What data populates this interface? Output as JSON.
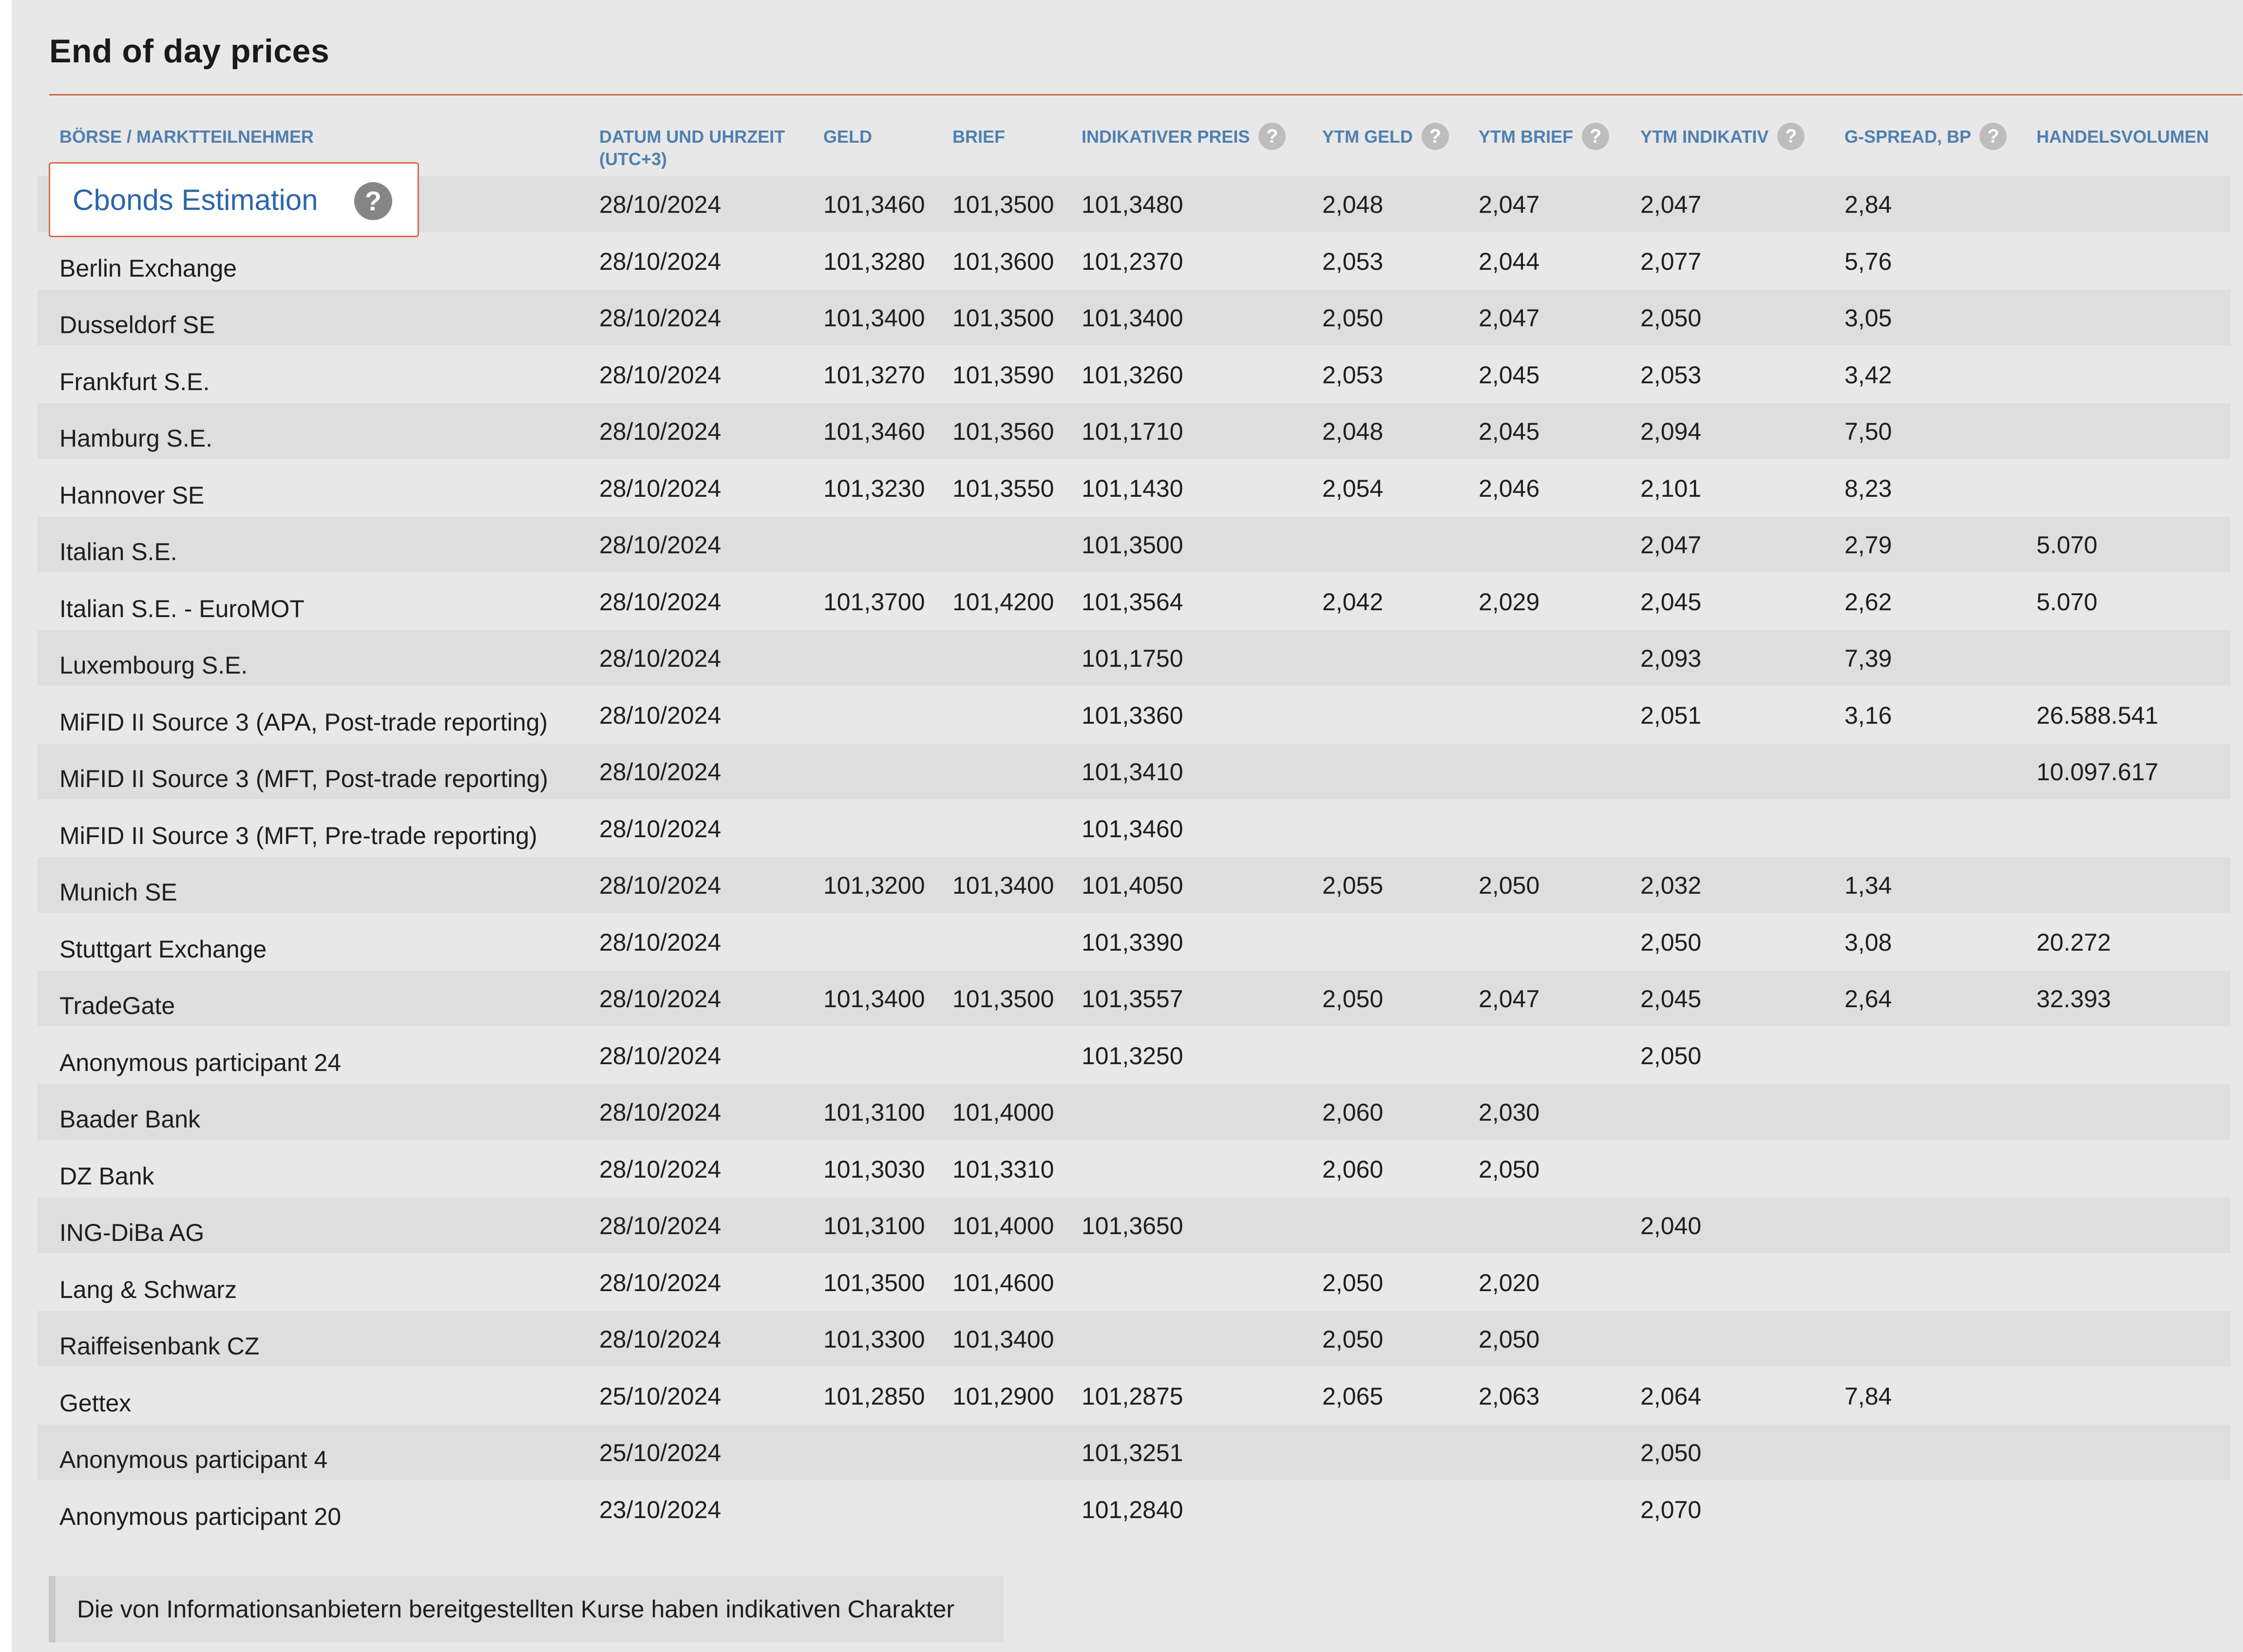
{
  "title": "End of day prices",
  "headers": {
    "exchange": "BÖRSE / MARKTTEILNEHMER",
    "datetime_line1": "DATUM UND UHRZEIT",
    "datetime_line2": "(UTC+3)",
    "bid": "GELD",
    "ask": "BRIEF",
    "indicative": "INDIKATIVER PREIS",
    "ytm_bid": "YTM GELD",
    "ytm_ask": "YTM BRIEF",
    "ytm_indicative": "YTM INDIKATIV",
    "g_spread": "G-SPREAD, BP",
    "volume": "HANDELSVOLUMEN"
  },
  "help_glyph": "?",
  "cbonds_link": "Cbonds Estimation",
  "rows": [
    {
      "name": "",
      "date": "28/10/2024",
      "bid": "101,3460",
      "ask": "101,3500",
      "ind": "101,3480",
      "ytm_bid": "2,048",
      "ytm_ask": "2,047",
      "ytm_ind": "2,047",
      "spread": "2,84",
      "vol": ""
    },
    {
      "name": "Berlin Exchange",
      "date": "28/10/2024",
      "bid": "101,3280",
      "ask": "101,3600",
      "ind": "101,2370",
      "ytm_bid": "2,053",
      "ytm_ask": "2,044",
      "ytm_ind": "2,077",
      "spread": "5,76",
      "vol": ""
    },
    {
      "name": "Dusseldorf SE",
      "date": "28/10/2024",
      "bid": "101,3400",
      "ask": "101,3500",
      "ind": "101,3400",
      "ytm_bid": "2,050",
      "ytm_ask": "2,047",
      "ytm_ind": "2,050",
      "spread": "3,05",
      "vol": ""
    },
    {
      "name": "Frankfurt S.E.",
      "date": "28/10/2024",
      "bid": "101,3270",
      "ask": "101,3590",
      "ind": "101,3260",
      "ytm_bid": "2,053",
      "ytm_ask": "2,045",
      "ytm_ind": "2,053",
      "spread": "3,42",
      "vol": ""
    },
    {
      "name": "Hamburg S.E.",
      "date": "28/10/2024",
      "bid": "101,3460",
      "ask": "101,3560",
      "ind": "101,1710",
      "ytm_bid": "2,048",
      "ytm_ask": "2,045",
      "ytm_ind": "2,094",
      "spread": "7,50",
      "vol": ""
    },
    {
      "name": "Hannover SE",
      "date": "28/10/2024",
      "bid": "101,3230",
      "ask": "101,3550",
      "ind": "101,1430",
      "ytm_bid": "2,054",
      "ytm_ask": "2,046",
      "ytm_ind": "2,101",
      "spread": "8,23",
      "vol": ""
    },
    {
      "name": "Italian S.E.",
      "date": "28/10/2024",
      "bid": "",
      "ask": "",
      "ind": "101,3500",
      "ytm_bid": "",
      "ytm_ask": "",
      "ytm_ind": "2,047",
      "spread": "2,79",
      "vol": "5.070"
    },
    {
      "name": "Italian S.E. - EuroMOT",
      "date": "28/10/2024",
      "bid": "101,3700",
      "ask": "101,4200",
      "ind": "101,3564",
      "ytm_bid": "2,042",
      "ytm_ask": "2,029",
      "ytm_ind": "2,045",
      "spread": "2,62",
      "vol": "5.070"
    },
    {
      "name": "Luxembourg S.E.",
      "date": "28/10/2024",
      "bid": "",
      "ask": "",
      "ind": "101,1750",
      "ytm_bid": "",
      "ytm_ask": "",
      "ytm_ind": "2,093",
      "spread": "7,39",
      "vol": ""
    },
    {
      "name": "MiFID II Source 3 (APA, Post-trade reporting)",
      "date": "28/10/2024",
      "bid": "",
      "ask": "",
      "ind": "101,3360",
      "ytm_bid": "",
      "ytm_ask": "",
      "ytm_ind": "2,051",
      "spread": "3,16",
      "vol": "26.588.541"
    },
    {
      "name": "MiFID II Source 3 (MFT, Post-trade reporting)",
      "date": "28/10/2024",
      "bid": "",
      "ask": "",
      "ind": "101,3410",
      "ytm_bid": "",
      "ytm_ask": "",
      "ytm_ind": "",
      "spread": "",
      "vol": "10.097.617"
    },
    {
      "name": "MiFID II Source 3 (MFT, Pre-trade reporting)",
      "date": "28/10/2024",
      "bid": "",
      "ask": "",
      "ind": "101,3460",
      "ytm_bid": "",
      "ytm_ask": "",
      "ytm_ind": "",
      "spread": "",
      "vol": ""
    },
    {
      "name": "Munich SE",
      "date": "28/10/2024",
      "bid": "101,3200",
      "ask": "101,3400",
      "ind": "101,4050",
      "ytm_bid": "2,055",
      "ytm_ask": "2,050",
      "ytm_ind": "2,032",
      "spread": "1,34",
      "vol": ""
    },
    {
      "name": "Stuttgart Exchange",
      "date": "28/10/2024",
      "bid": "",
      "ask": "",
      "ind": "101,3390",
      "ytm_bid": "",
      "ytm_ask": "",
      "ytm_ind": "2,050",
      "spread": "3,08",
      "vol": "20.272"
    },
    {
      "name": "TradeGate",
      "date": "28/10/2024",
      "bid": "101,3400",
      "ask": "101,3500",
      "ind": "101,3557",
      "ytm_bid": "2,050",
      "ytm_ask": "2,047",
      "ytm_ind": "2,045",
      "spread": "2,64",
      "vol": "32.393"
    },
    {
      "name": "Anonymous participant 24",
      "date": "28/10/2024",
      "bid": "",
      "ask": "",
      "ind": "101,3250",
      "ytm_bid": "",
      "ytm_ask": "",
      "ytm_ind": "2,050",
      "spread": "",
      "vol": ""
    },
    {
      "name": "Baader Bank",
      "date": "28/10/2024",
      "bid": "101,3100",
      "ask": "101,4000",
      "ind": "",
      "ytm_bid": "2,060",
      "ytm_ask": "2,030",
      "ytm_ind": "",
      "spread": "",
      "vol": ""
    },
    {
      "name": "DZ Bank",
      "date": "28/10/2024",
      "bid": "101,3030",
      "ask": "101,3310",
      "ind": "",
      "ytm_bid": "2,060",
      "ytm_ask": "2,050",
      "ytm_ind": "",
      "spread": "",
      "vol": ""
    },
    {
      "name": "ING-DiBa AG",
      "date": "28/10/2024",
      "bid": "101,3100",
      "ask": "101,4000",
      "ind": "101,3650",
      "ytm_bid": "",
      "ytm_ask": "",
      "ytm_ind": "2,040",
      "spread": "",
      "vol": ""
    },
    {
      "name": "Lang & Schwarz",
      "date": "28/10/2024",
      "bid": "101,3500",
      "ask": "101,4600",
      "ind": "",
      "ytm_bid": "2,050",
      "ytm_ask": "2,020",
      "ytm_ind": "",
      "spread": "",
      "vol": ""
    },
    {
      "name": "Raiffeisenbank CZ",
      "date": "28/10/2024",
      "bid": "101,3300",
      "ask": "101,3400",
      "ind": "",
      "ytm_bid": "2,050",
      "ytm_ask": "2,050",
      "ytm_ind": "",
      "spread": "",
      "vol": ""
    },
    {
      "name": "Gettex",
      "date": "25/10/2024",
      "bid": "101,2850",
      "ask": "101,2900",
      "ind": "101,2875",
      "ytm_bid": "2,065",
      "ytm_ask": "2,063",
      "ytm_ind": "2,064",
      "spread": "7,84",
      "vol": ""
    },
    {
      "name": "Anonymous participant 4",
      "date": "25/10/2024",
      "bid": "",
      "ask": "",
      "ind": "101,3251",
      "ytm_bid": "",
      "ytm_ask": "",
      "ytm_ind": "2,050",
      "spread": "",
      "vol": ""
    },
    {
      "name": "Anonymous participant 20",
      "date": "23/10/2024",
      "bid": "",
      "ask": "",
      "ind": "101,2840",
      "ytm_bid": "",
      "ytm_ask": "",
      "ytm_ind": "2,070",
      "spread": "",
      "vol": ""
    }
  ],
  "footnote": "Die von Informationsanbietern bereitgestellten Kurse haben indikativen Charakter",
  "colors": {
    "accent_line": "#c8664a",
    "header_text": "#4f7fb0",
    "link_text": "#2a67a8",
    "panel_bg": "#e8e8e8",
    "alt_row_bg": "#dedede"
  }
}
